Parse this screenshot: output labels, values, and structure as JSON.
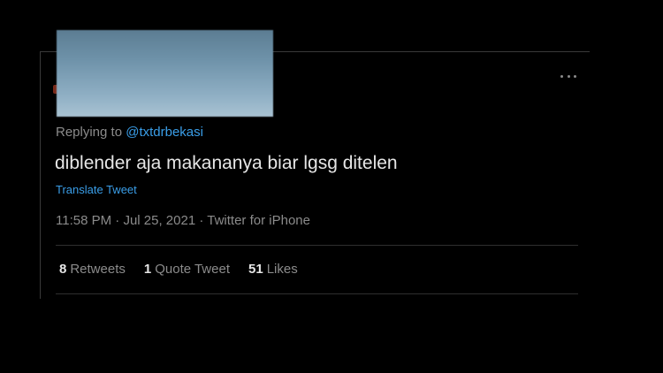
{
  "tweet": {
    "replying_prefix": "Replying to",
    "replying_handle": "@txtdrbekasi",
    "text": "diblender aja makananya biar lgsg ditelen",
    "translate_label": "Translate Tweet",
    "time": "11:58 PM",
    "separator": "·",
    "date": "Jul 25, 2021",
    "source": "Twitter for iPhone"
  },
  "stats": [
    {
      "count": "8",
      "label": "Retweets"
    },
    {
      "count": "1",
      "label": "Quote Tweet"
    },
    {
      "count": "51",
      "label": "Likes"
    }
  ],
  "icons": {
    "more": "more-horizontal-icon"
  },
  "colors": {
    "background": "#000000",
    "link": "#3a9ee8",
    "muted": "#8b8b8b",
    "text": "#e6e6e6"
  }
}
